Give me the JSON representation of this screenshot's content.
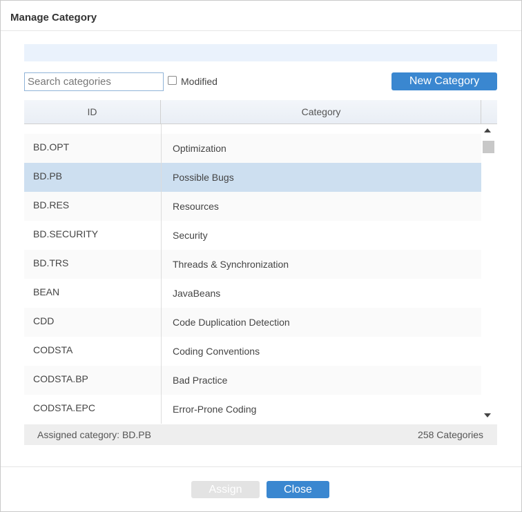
{
  "dialog": {
    "title": "Manage Category"
  },
  "toolbar": {
    "search_placeholder": "Search categories",
    "search_value": "",
    "modified_label": "Modified",
    "modified_checked": false,
    "new_category_label": "New Category"
  },
  "table": {
    "columns": [
      "ID",
      "Category"
    ],
    "rows": [
      {
        "id": "BD.OPT",
        "category": "Optimization"
      },
      {
        "id": "BD.PB",
        "category": "Possible Bugs",
        "selected": true
      },
      {
        "id": "BD.RES",
        "category": "Resources"
      },
      {
        "id": "BD.SECURITY",
        "category": "Security"
      },
      {
        "id": "BD.TRS",
        "category": "Threads & Synchronization"
      },
      {
        "id": "BEAN",
        "category": "JavaBeans"
      },
      {
        "id": "CDD",
        "category": "Code Duplication Detection"
      },
      {
        "id": "CODSTA",
        "category": "Coding Conventions"
      },
      {
        "id": "CODSTA.BP",
        "category": "Bad Practice"
      },
      {
        "id": "CODSTA.EPC",
        "category": "Error-Prone Coding"
      }
    ]
  },
  "status": {
    "assigned_text": "Assigned category: BD.PB",
    "count_text": "258 Categories"
  },
  "footer": {
    "assign_label": "Assign",
    "assign_disabled": true,
    "close_label": "Close"
  },
  "colors": {
    "accent": "#3a87d0",
    "selected_row": "#cddff0",
    "banner": "#eaf2fc"
  }
}
